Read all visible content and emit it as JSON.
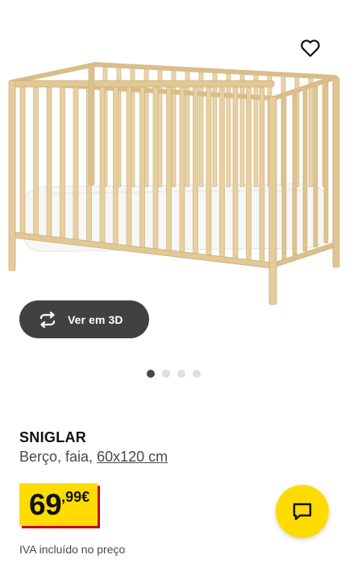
{
  "product": {
    "name": "SNIGLAR",
    "description": "Berço, faia,",
    "dimensions": "60x120 cm",
    "image_icon": "crib-image"
  },
  "actions": {
    "view_3d_label": "Ver em 3D",
    "favorite_icon": "heart-icon",
    "chat_icon": "chat-icon"
  },
  "carousel": {
    "total": 4,
    "active_index": 0
  },
  "price": {
    "integer": "69",
    "decimal": ",99",
    "currency": "€",
    "note": "IVA incluído no preço"
  },
  "colors": {
    "price_bg": "#ffdb00",
    "price_shadow": "#cc0008",
    "button_dark": "#414141",
    "wood": "#e6cc9c"
  }
}
